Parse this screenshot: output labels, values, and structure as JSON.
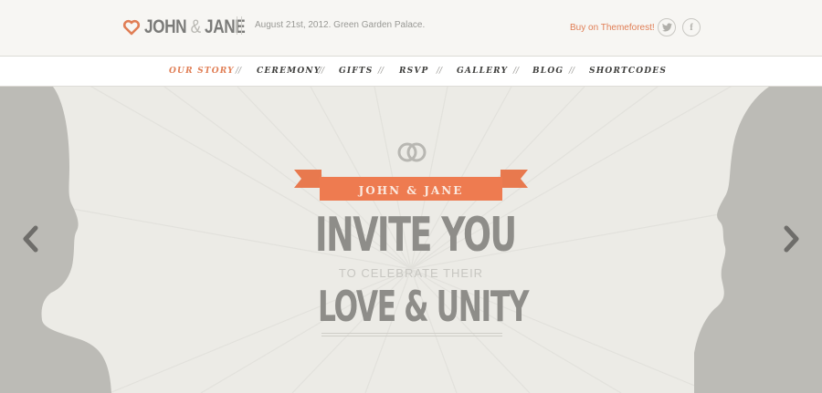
{
  "header": {
    "logo_name1": "JOHN",
    "logo_amp": "&",
    "logo_name2": "JANE",
    "tagline": "August 21st, 2012. Green Garden Palace.",
    "buy_label": "Buy on Themeforest!",
    "social": {
      "twitter": "twitter-icon",
      "facebook": "facebook-icon"
    }
  },
  "nav": {
    "items": [
      "OUR STORY",
      "CEREMONY",
      "GIFTS",
      "RSVP",
      "GALLERY",
      "BLOG",
      "SHORTCODES"
    ],
    "separator": "//",
    "active_index": 0
  },
  "hero": {
    "ribbon_text": "JOHN & JANE",
    "line1": "INVITE YOU",
    "line2": "TO CELEBRATE THEIR",
    "line3": "LOVE & UNITY",
    "icons": {
      "rings": "rings-icon",
      "prev": "chevron-left-icon",
      "next": "chevron-right-icon"
    }
  },
  "colors": {
    "accent": "#e07e55",
    "ribbon": "#e8794e",
    "silhouette": "#bcbbb6",
    "text": "#8e8d89"
  }
}
